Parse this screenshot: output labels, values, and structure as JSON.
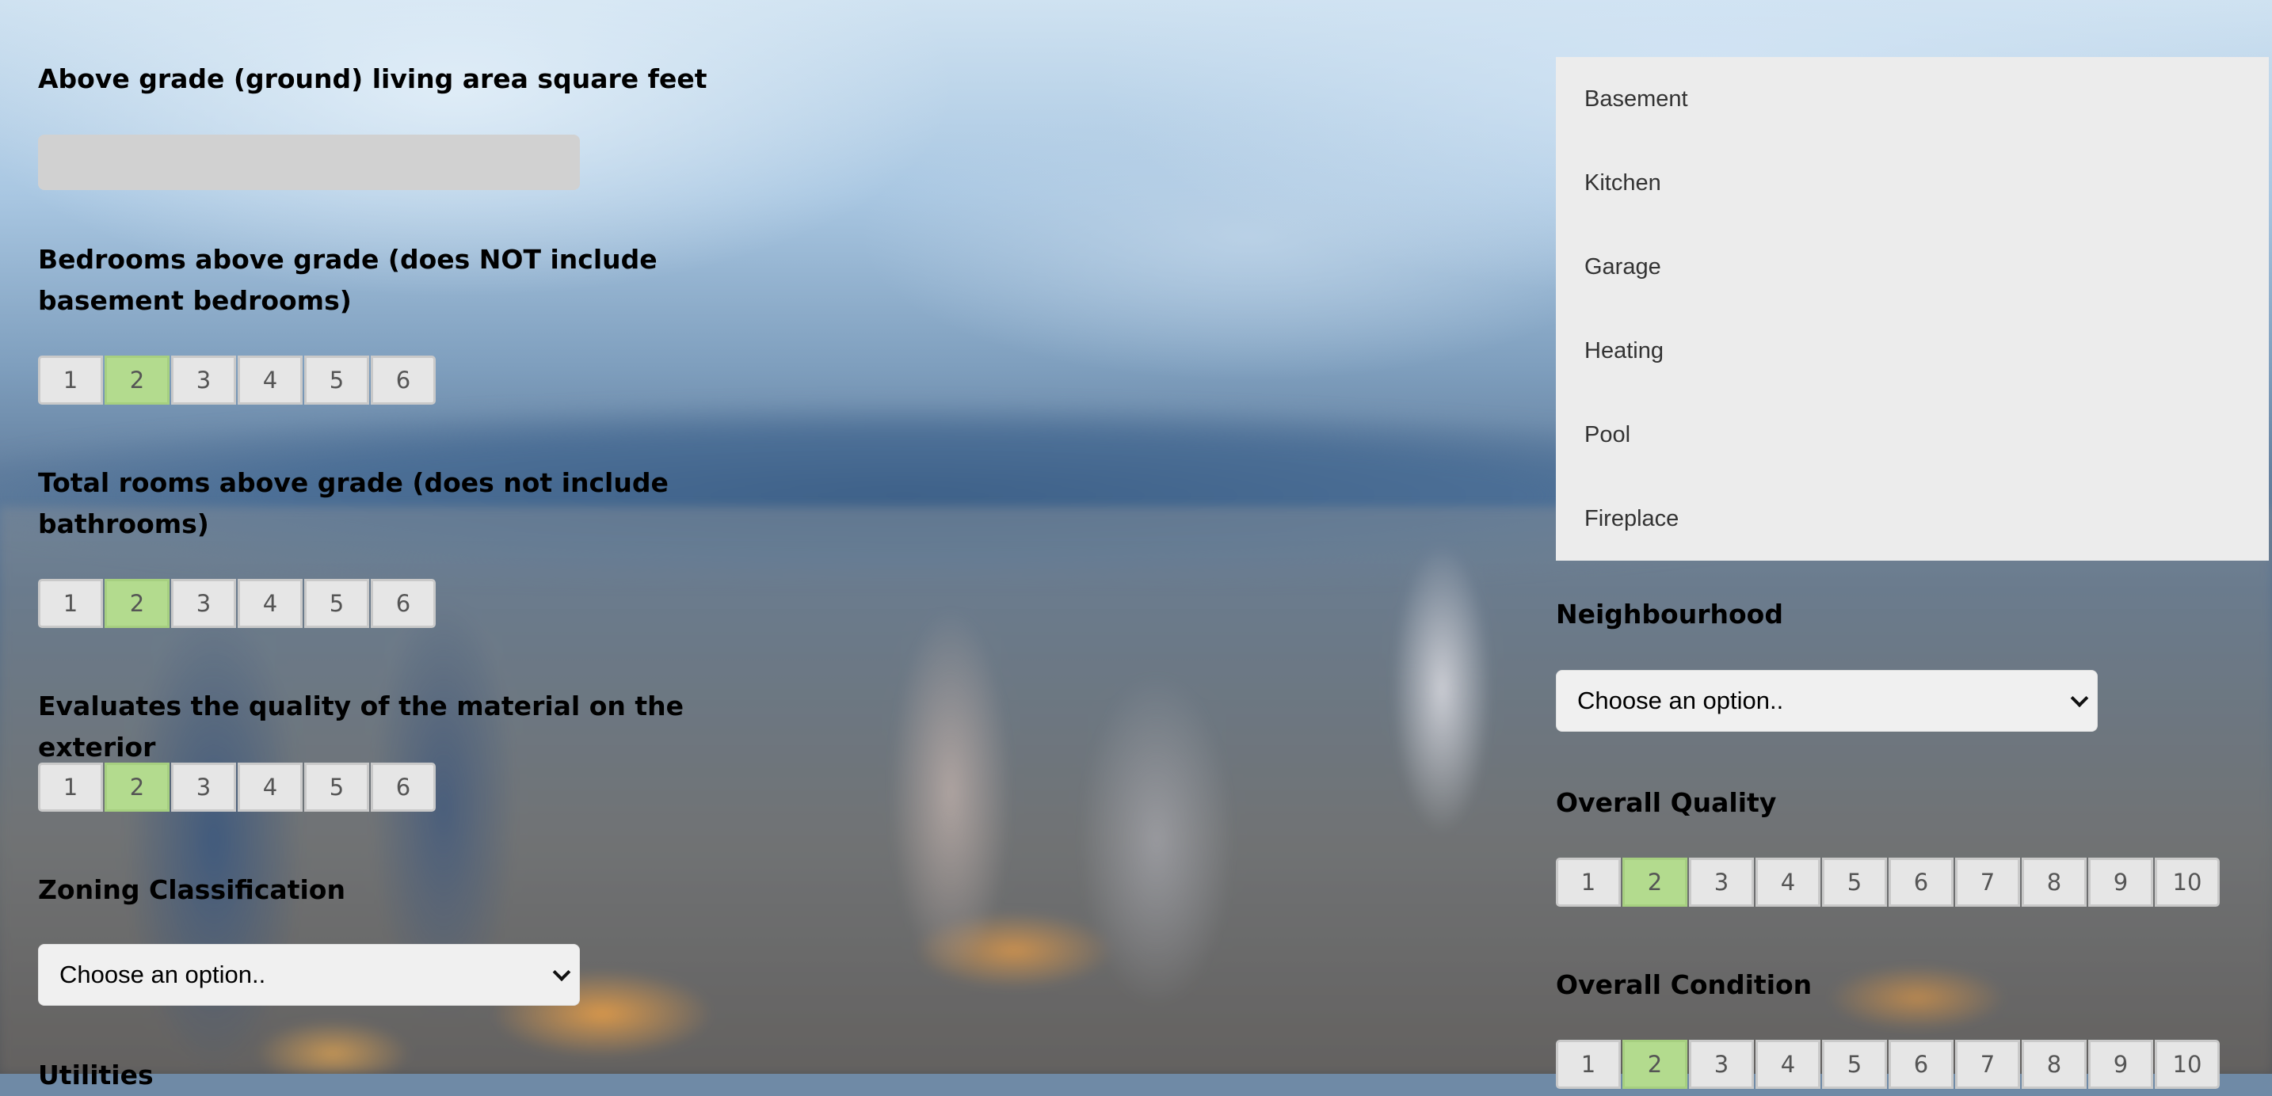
{
  "left": {
    "living_area": {
      "label": "Above grade (ground) living area square feet",
      "value": ""
    },
    "bedrooms": {
      "label": "Bedrooms above grade (does NOT include basement bedrooms)",
      "options": [
        "1",
        "2",
        "3",
        "4",
        "5",
        "6"
      ],
      "selected": "2"
    },
    "total_rooms": {
      "label": "Total rooms above grade (does not include bathrooms)",
      "options": [
        "1",
        "2",
        "3",
        "4",
        "5",
        "6"
      ],
      "selected": "2"
    },
    "exterior_quality": {
      "label": "Evaluates the quality of the material on the exterior",
      "options": [
        "1",
        "2",
        "3",
        "4",
        "5",
        "6"
      ],
      "selected": "2"
    },
    "zoning": {
      "label": "Zoning Classification",
      "selected_text": "Choose an option.."
    },
    "utilities": {
      "label": "Utilities"
    }
  },
  "right": {
    "menu_items": [
      "Basement",
      "Kitchen",
      "Garage",
      "Heating",
      "Pool",
      "Fireplace"
    ],
    "neighbourhood": {
      "label": "Neighbourhood",
      "selected_text": "Choose an option.."
    },
    "overall_quality": {
      "label": "Overall Quality",
      "options": [
        "1",
        "2",
        "3",
        "4",
        "5",
        "6",
        "7",
        "8",
        "9",
        "10"
      ],
      "selected": "2"
    },
    "overall_condition": {
      "label": "Overall Condition",
      "options": [
        "1",
        "2",
        "3",
        "4",
        "5",
        "6",
        "7",
        "8",
        "9",
        "10"
      ],
      "selected": "2"
    }
  },
  "colors": {
    "selected_segment": "#b3db8e",
    "segment": "#e6e6e6",
    "input": "#d1d1d1",
    "menu": "#ececec"
  }
}
